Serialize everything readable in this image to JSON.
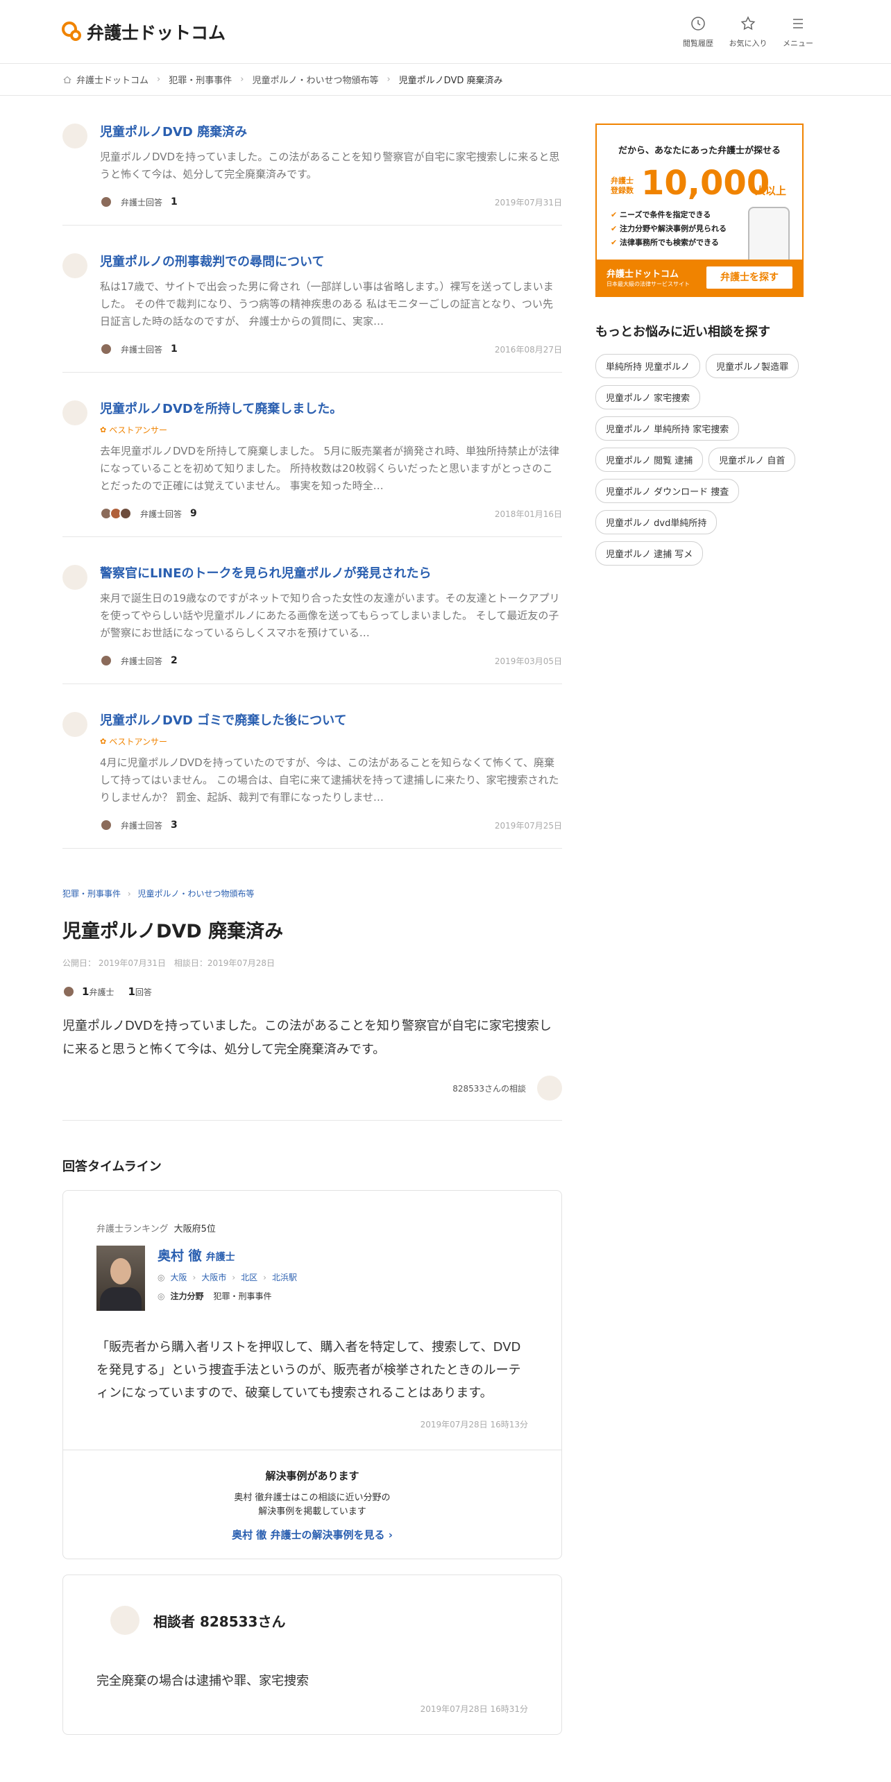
{
  "header": {
    "logo": "弁護士ドットコム",
    "nav": [
      {
        "label": "閲覧履歴",
        "icon": "history-icon"
      },
      {
        "label": "お気に入り",
        "icon": "star-icon"
      },
      {
        "label": "メニュー",
        "icon": "menu-icon"
      }
    ]
  },
  "breadcrumb": [
    "弁護士ドットコム",
    "犯罪・刑事事件",
    "児童ポルノ・わいせつ物頒布等",
    "児童ポルノDVD 廃棄済み"
  ],
  "questions": [
    {
      "title": "児童ポルノDVD 廃棄済み",
      "best": "",
      "body": "児童ポルノDVDを持っていました。この法があることを知り警察官が自宅に家宅捜索しに来ると思うと怖くて今は、処分して完全廃棄済みです。",
      "label": "弁護士回答",
      "count": "1",
      "date": "2019年07月31日"
    },
    {
      "title": "児童ポルノの刑事裁判での尋問について",
      "best": "",
      "body": "私は17歳で、サイトで出会った男に脅され（一部詳しい事は省略します。）裸写を送ってしまいました。 その件で裁判になり、うつ病等の精神疾患のある 私はモニターごしの証言となり、つい先日証言した時の話なのですが、 弁護士からの質問に、実家…",
      "label": "弁護士回答",
      "count": "1",
      "date": "2016年08月27日"
    },
    {
      "title": "児童ポルノDVDを所持して廃棄しました。",
      "best": "ベストアンサー",
      "body": "去年児童ポルノDVDを所持して廃棄しました。 5月に販売業者が摘発され時、単独所持禁止が法律になっていることを初めて知りました。 所持枚数は20枚弱くらいだったと思いますがとっさのことだったので正確には覚えていません。 事実を知った時全…",
      "label": "弁護士回答",
      "count": "9",
      "date": "2018年01月16日"
    },
    {
      "title": "警察官にLINEのトークを見られ児童ポルノが発見されたら",
      "best": "",
      "body": "来月で誕生日の19歳なのですがネットで知り合った女性の友達がいます。その友達とトークアプリを使ってやらしい話や児童ポルノにあたる画像を送ってもらってしまいました。 そして最近友の子が警察にお世話になっているらしくスマホを預けている…",
      "label": "弁護士回答",
      "count": "2",
      "date": "2019年03月05日"
    },
    {
      "title": "児童ポルノDVD ゴミで廃棄した後について",
      "best": "ベストアンサー",
      "body": "4月に児童ポルノDVDを持っていたのですが、今は、この法があることを知らなくて怖くて、廃棄して持ってはいません。 この場合は、自宅に来て逮捕状を持って逮捕しに来たり、家宅捜索されたりしませんか？ 罰金、起訴、裁判で有罪になったりしませ…",
      "label": "弁護士回答",
      "count": "3",
      "date": "2019年07月25日"
    }
  ],
  "detail": {
    "crumbs": [
      "犯罪・刑事事件",
      "児童ポルノ・わいせつ物頒布等"
    ],
    "title": "児童ポルノDVD 廃棄済み",
    "dates": "公開日： 2019年07月31日　相談日：2019年07月28日",
    "lawyer_count": "1",
    "lawyer_label": "弁護士",
    "answer_count": "1",
    "answer_label": "回答",
    "body": "児童ポルノDVDを持っていました。この法があることを知り警察官が自宅に家宅捜索しに来ると思うと怖くて今は、処分して完全廃棄済みです。",
    "asker": "828533さんの相談"
  },
  "timeline": {
    "heading": "回答タイムライン",
    "ranking_label": "弁護士ランキング",
    "ranking_value": "大阪府5位",
    "lawyer_name": "奥村 徹",
    "lawyer_title": "弁護士",
    "locations": [
      "大阪",
      "大阪市",
      "北区",
      "北浜駅"
    ],
    "spec_label": "注力分野",
    "spec_value": "犯罪・刑事事件",
    "answer": "「販売者から購入者リストを押収して、購入者を特定して、捜索して、DVDを発見する」という捜査手法というのが、販売者が検挙されたときのルーティンになっていますので、破棄していても捜索されることはあります。",
    "answer_time": "2019年07月28日 16時13分",
    "cases_title": "解決事例があります",
    "cases_desc1": "奥村 徹弁護士はこの相談に近い分野の",
    "cases_desc2": "解決事例を掲載しています",
    "cases_link": "奥村 徹 弁護士の解決事例を見る ›",
    "client_name": "相談者 828533さん",
    "client_body": "完全廃棄の場合は逮捕や罪、家宅捜索",
    "client_time": "2019年07月28日 16時31分"
  },
  "ad": {
    "headline": "だから、あなたにあった弁護士が探せる",
    "reg_label1": "弁護士",
    "reg_label2": "登録数",
    "count": "10,000",
    "suffix": "人以上",
    "features": [
      "ニーズで条件を指定できる",
      "注力分野や解決事例が見られる",
      "法律事務所でも検索ができる"
    ],
    "brand": "弁護士ドットコム",
    "brand_sub": "日本最大級の法律サービスサイト",
    "cta": "弁護士を探す"
  },
  "sidebar": {
    "heading": "もっとお悩みに近い相談を探す",
    "tags": [
      "単純所持 児童ポルノ",
      "児童ポルノ製造罪",
      "児童ポルノ 家宅捜索",
      "児童ポルノ 単純所持 家宅捜索",
      "児童ポルノ 閲覧 逮捕",
      "児童ポルノ 自首",
      "児童ポルノ ダウンロード 捜査",
      "児童ポルノ dvd単純所持",
      "児童ポルノ 逮捕 写メ"
    ]
  }
}
